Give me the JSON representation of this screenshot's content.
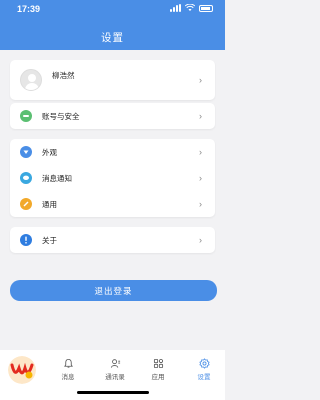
{
  "status": {
    "time": "17:39"
  },
  "header": {
    "title": "设置"
  },
  "profile": {
    "name": "柳浩然"
  },
  "menu": {
    "account": "账号与安全",
    "appearance": "外观",
    "notifications": "消息通知",
    "general": "通用",
    "about": "关于"
  },
  "logout_label": "退出登录",
  "tabs": [
    {
      "label": "消息",
      "icon": "bell-icon"
    },
    {
      "label": "通讯录",
      "icon": "contacts-icon"
    },
    {
      "label": "应用",
      "icon": "apps-icon"
    },
    {
      "label": "设置",
      "icon": "gear-icon"
    }
  ],
  "colors": {
    "accent": "#4a8ee6",
    "background": "#f2f2f4",
    "account_icon": "#5bbf72",
    "appearance_icon": "#4a8ee6",
    "notifications_icon": "#3aa8e0",
    "general_icon": "#f2a92a",
    "about_icon": "#2f7de0"
  }
}
